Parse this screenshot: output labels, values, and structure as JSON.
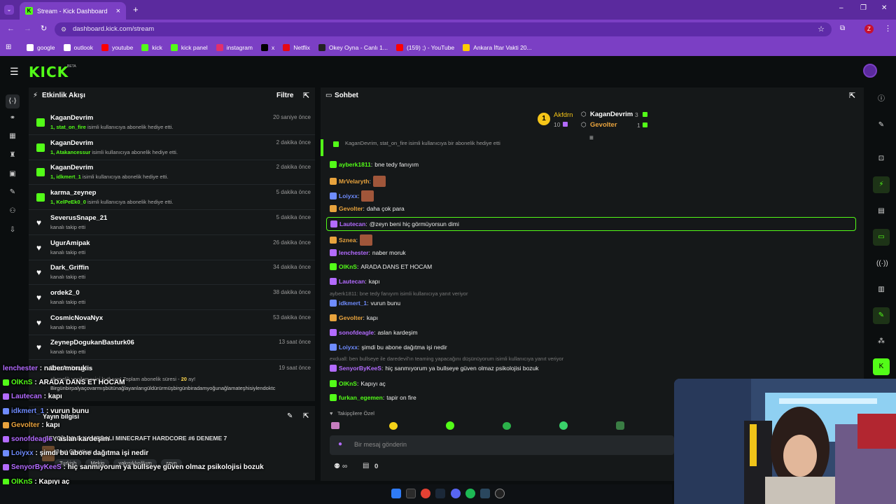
{
  "browser": {
    "tab_title": "Stream - Kick Dashboard",
    "url": "dashboard.kick.com/stream",
    "profile_initial": "Z",
    "bookmarks": [
      {
        "label": "google",
        "color": "#ffffff"
      },
      {
        "label": "outlook",
        "color": "#ffffff"
      },
      {
        "label": "youtube",
        "color": "#ff0000"
      },
      {
        "label": "kick",
        "color": "#53fc18"
      },
      {
        "label": "kick panel",
        "color": "#53fc18"
      },
      {
        "label": "instagram",
        "color": "#e1306c"
      },
      {
        "label": "x",
        "color": "#000000"
      },
      {
        "label": "Netflix",
        "color": "#e50914"
      },
      {
        "label": "Okey Oyna - Canlı 1...",
        "color": "#222222"
      },
      {
        "label": "(159) ;) - YouTube",
        "color": "#ff0000"
      },
      {
        "label": "Ankara İftar Vakti 20...",
        "color": "#ffcc00"
      }
    ]
  },
  "kick": {
    "logo": "KICK",
    "beta": "BETA",
    "accent": "#53fc18"
  },
  "activity": {
    "title": "Etkinlik Akışı",
    "filter": "Filtre",
    "items": [
      {
        "type": "gift",
        "name": "KaganDevrim",
        "target": "1, stat_on_fire",
        "desc": " isimli kullanıcıya abonelik hediye etti.",
        "time": "20 saniye önce"
      },
      {
        "type": "gift",
        "name": "KaganDevrim",
        "target": "1, Atakancessur",
        "desc": " isimli kullanıcıya abonelik hediye etti.",
        "time": "2 dakika önce"
      },
      {
        "type": "gift",
        "name": "KaganDevrim",
        "target": "1, idkmert_1",
        "desc": " isimli kullanıcıya abonelik hediye etti.",
        "time": "2 dakika önce"
      },
      {
        "type": "gift",
        "name": "karma_zeynep",
        "target": "1, KelPeEk0_0",
        "desc": " isimli kullanıcıya abonelik hediye etti.",
        "time": "5 dakika önce"
      },
      {
        "type": "follow",
        "name": "SeverusSnape_21",
        "target": "",
        "desc": "kanalı takip etti",
        "time": "5 dakika önce"
      },
      {
        "type": "follow",
        "name": "UgurAmipak",
        "target": "",
        "desc": "kanalı takip etti",
        "time": "26 dakika önce"
      },
      {
        "type": "follow",
        "name": "Dark_Griffin",
        "target": "",
        "desc": "kanalı takip etti",
        "time": "34 dakika önce"
      },
      {
        "type": "follow",
        "name": "ordek2_0",
        "target": "",
        "desc": "kanalı takip etti",
        "time": "38 dakika önce"
      },
      {
        "type": "follow",
        "name": "CosmicNovaNyx",
        "target": "",
        "desc": "kanalı takip etti",
        "time": "53 dakika önce"
      },
      {
        "type": "follow",
        "name": "ZeynepDogukanBasturk06",
        "target": "",
        "desc": "kanalı takip etti",
        "time": "13 saat önce"
      }
    ],
    "partial_name": "TheAninoglis",
    "partial_time": "19 saat önce",
    "partial_desc": "abonelik yenilemesini kutluyor! Toplam abonelik süresi - ",
    "partial_months": "20",
    "partial_suffix": " ay!",
    "partial_msg": "Birgünbirpalyaçovarmışbütünağlayanlarıgüldürürmüşbirgünbiradamyoğunağlamateşhisiylendoktc"
  },
  "stream_info": {
    "title": "Yayın bilgisi",
    "stream_title": "SEVGİLİMLE KAMERALI MINECRAFT HARDCORE #6 DENEME 7",
    "category": "Just Chatting",
    "tags": [
      "Turkish",
      "Mekip",
      "yakışıklıoğlum",
      "zeyn"
    ]
  },
  "chat": {
    "title": "Sohbet",
    "leaderboard": [
      {
        "name": "Akfdrn",
        "count": "10",
        "rank": "1"
      },
      {
        "name": "KaganDevrim",
        "count": "3"
      },
      {
        "name": "Gevolter",
        "count": "1"
      }
    ],
    "pinned": "KaganDevrim, stat_on_fire isimli kullanıcıya bir abonelik hediye etti",
    "messages": [
      {
        "user": "ayberk1811",
        "color": "#53fc18",
        "text": "bne tedy fanıyım"
      },
      {
        "user": "MrVelaryth",
        "color": "#e8a33d",
        "text": ""
      },
      {
        "user": "Loiyxx",
        "color": "#6f8cff",
        "text": ""
      },
      {
        "user": "Gevolter",
        "color": "#e8a33d",
        "text": "daha çok para"
      },
      {
        "user": "Lautecan",
        "color": "#b36bff",
        "text": "@zeyn beni hiç görmüyorsun dimi"
      },
      {
        "user": "Sznea",
        "color": "#e8a33d",
        "text": ""
      },
      {
        "user": "lenchester",
        "color": "#b36bff",
        "text": "naber moruk"
      },
      {
        "user": "OlKnS",
        "color": "#53fc18",
        "text": "ARADA DANS ET HOCAM"
      },
      {
        "user": "Lautecan",
        "color": "#b36bff",
        "text": "kapı"
      },
      {
        "user": "idkmert_1",
        "color": "#6f8cff",
        "text": "vurun bunu",
        "reply": "ayberk1811: bne tedy fanıyım isimli kullanıcıya yanıt veriyor"
      },
      {
        "user": "Gevolter",
        "color": "#e8a33d",
        "text": "kapı"
      },
      {
        "user": "sonofdeagle",
        "color": "#b36bff",
        "text": "aslan kardeşim"
      },
      {
        "user": "Loiyxx",
        "color": "#6f8cff",
        "text": "şimdi bu abone dağıtma işi nedir"
      },
      {
        "user": "SenyorByKeeS",
        "color": "#b36bff",
        "text": "hiç sanmıyorum ya bullseye güven olmaz psikolojisi bozuk",
        "reply": "exduall: ben bullseye ile daredevil'ın teaming yapacağını düşünüyorum isimli kullanıcıya yanıt veriyor"
      },
      {
        "user": "OlKnS",
        "color": "#53fc18",
        "text": "Kapıyı aç"
      },
      {
        "user": "furkan_egemen",
        "color": "#53fc18",
        "text": "tapir on fire"
      }
    ],
    "followers_only": "Takipçilere Özel",
    "input_placeholder": "Bir mesaj gönderin",
    "viewers": "∞",
    "chest_count": "0"
  },
  "overlay": [
    {
      "user": "lenchester",
      "color": "#b36bff",
      "text": "naber moruk"
    },
    {
      "user": "OlKnS",
      "color": "#53fc18",
      "text": "ARADA DANS ET HOCAM"
    },
    {
      "user": "Lautecan",
      "color": "#b36bff",
      "text": "kapı"
    },
    {
      "user": "idkmert_1",
      "color": "#6f8cff",
      "text": "vurun bunu"
    },
    {
      "user": "Gevolter",
      "color": "#e8a33d",
      "text": "kapı"
    },
    {
      "user": "sonofdeagle",
      "color": "#b36bff",
      "text": "aslan kardeşim"
    },
    {
      "user": "Loiyxx",
      "color": "#6f8cff",
      "text": "şimdi bu abone dağıtma işi nedir"
    },
    {
      "user": "SenyorByKeeS",
      "color": "#b36bff",
      "text": "hiç sanmıyorum ya bullseye güven olmaz psikolojisi bozuk"
    },
    {
      "user": "OlKnS",
      "color": "#53fc18",
      "text": "Kapıyı aç"
    },
    {
      "user": "furkan_egemen",
      "color": "#53fc18",
      "text": "tapir on fire"
    }
  ]
}
